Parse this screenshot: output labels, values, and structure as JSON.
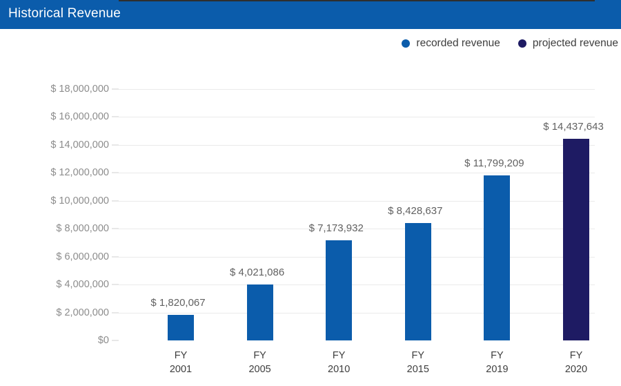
{
  "header": {
    "title": "Historical Revenue",
    "background_color": "#0b5cab",
    "text_color": "#ffffff"
  },
  "legend": {
    "position": "top-right",
    "items": [
      {
        "label": "recorded revenue",
        "color": "#0b5cab",
        "icon": "legend-dot-icon"
      },
      {
        "label": "projected revenue",
        "color": "#1e1b63",
        "icon": "legend-dot-icon"
      }
    ]
  },
  "chart_data": {
    "type": "bar",
    "title": "Historical Revenue",
    "xlabel": "",
    "ylabel": "",
    "ylim": [
      0,
      18000000
    ],
    "ytick_step": 2000000,
    "grid": true,
    "legend_position": "top-right",
    "categories": [
      "FY\n2001",
      "FY\n2005",
      "FY\n2010",
      "FY\n2015",
      "FY\n2019",
      "FY\n2020"
    ],
    "values": [
      1820067,
      4021086,
      7173932,
      8428637,
      11799209,
      14437643
    ],
    "value_labels": [
      "$ 1,820,067",
      "$ 4,021,086",
      "$ 7,173,932",
      "$ 8,428,637",
      "$ 11,799,209",
      "$ 14,437,643"
    ],
    "series": [
      {
        "name": "recorded revenue",
        "color": "#0b5cab",
        "categories": [
          "FY\n2001",
          "FY\n2005",
          "FY\n2010",
          "FY\n2015",
          "FY\n2019"
        ],
        "values": [
          1820067,
          4021086,
          7173932,
          8428637,
          11799209
        ]
      },
      {
        "name": "projected revenue",
        "color": "#1e1b63",
        "categories": [
          "FY\n2020"
        ],
        "values": [
          14437643
        ]
      }
    ],
    "bar_colors": [
      "#0b5cab",
      "#0b5cab",
      "#0b5cab",
      "#0b5cab",
      "#0b5cab",
      "#1e1b63"
    ],
    "ytick_labels": [
      "$ 18,000,000",
      "$ 16,000,000",
      "$ 14,000,000",
      "$ 12,000,000",
      "$ 10,000,000",
      "$ 8,000,000",
      "$ 6,000,000",
      "$ 4,000,000",
      "$ 2,000,000",
      "$0"
    ],
    "ytick_values": [
      18000000,
      16000000,
      14000000,
      12000000,
      10000000,
      8000000,
      6000000,
      4000000,
      2000000,
      0
    ],
    "xtick_labels": [
      "FY\n2001",
      "FY\n2005",
      "FY\n2010",
      "FY\n2015",
      "FY\n2019",
      "FY\n2020"
    ]
  }
}
